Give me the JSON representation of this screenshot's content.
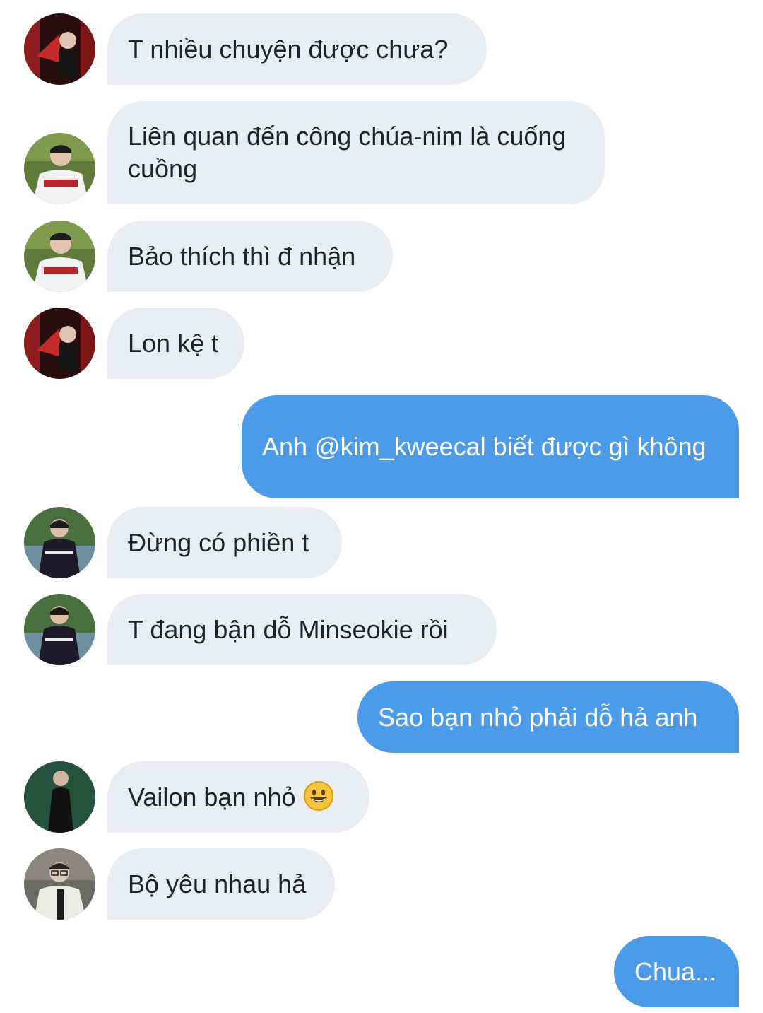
{
  "messages": [
    {
      "side": "in",
      "avatar": "avatar-red-fan",
      "text": "T nhiều chuyện được chưa?"
    },
    {
      "side": "in",
      "avatar": "avatar-baseball",
      "text": "Liên quan đến công chúa-nim là cuống cuồng"
    },
    {
      "side": "in",
      "avatar": "avatar-baseball",
      "text": "Bảo thích thì đ nhận"
    },
    {
      "side": "in",
      "avatar": "avatar-red-fan",
      "text": "Lon kệ t"
    },
    {
      "side": "out",
      "text": "Anh @kim_kweecal biết được gì không"
    },
    {
      "side": "in",
      "avatar": "avatar-outdoor-jersey",
      "text": "Đừng có phiền t"
    },
    {
      "side": "in",
      "avatar": "avatar-outdoor-jersey",
      "text": "T đang bận dỗ Minseokie rồi"
    },
    {
      "side": "out",
      "text": "Sao bạn nhỏ phải dỗ hả anh"
    },
    {
      "side": "in",
      "avatar": "avatar-dark-suit",
      "text": "Vailon bạn nhỏ",
      "emoji": "smiling-face-icon"
    },
    {
      "side": "in",
      "avatar": "avatar-glasses-jacket",
      "text": "Bộ yêu nhau hả"
    },
    {
      "side": "out",
      "text": "Chua..."
    }
  ],
  "colors": {
    "incoming_bubble": "#e9ecf0",
    "outgoing_bubble": "#4c9be8",
    "incoming_text": "#1f2328",
    "outgoing_text": "#ffffff"
  }
}
